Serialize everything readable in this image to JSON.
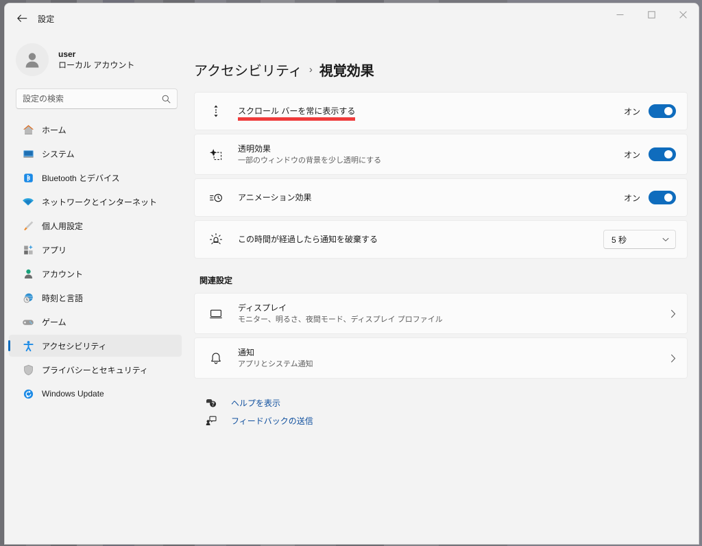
{
  "window": {
    "title": "設定",
    "back_label": "戻る",
    "minimize_label": "最小化",
    "maximize_label": "最大化",
    "close_label": "閉じる"
  },
  "sidebar": {
    "profile": {
      "name": "user",
      "account_type": "ローカル アカウント",
      "avatar_icon": "person-avatar-icon"
    },
    "search": {
      "placeholder": "設定の検索",
      "value": "",
      "icon": "search-icon"
    },
    "items": [
      {
        "label": "ホーム",
        "icon": "home-icon",
        "selected": false
      },
      {
        "label": "システム",
        "icon": "system-monitor-icon",
        "selected": false
      },
      {
        "label": "Bluetooth とデバイス",
        "icon": "bluetooth-icon",
        "selected": false
      },
      {
        "label": "ネットワークとインターネット",
        "icon": "wifi-icon",
        "selected": false
      },
      {
        "label": "個人用設定",
        "icon": "paintbrush-icon",
        "selected": false
      },
      {
        "label": "アプリ",
        "icon": "apps-icon",
        "selected": false
      },
      {
        "label": "アカウント",
        "icon": "account-person-icon",
        "selected": false
      },
      {
        "label": "時刻と言語",
        "icon": "clock-globe-icon",
        "selected": false
      },
      {
        "label": "ゲーム",
        "icon": "gamepad-icon",
        "selected": false
      },
      {
        "label": "アクセシビリティ",
        "icon": "accessibility-person-icon",
        "selected": true
      },
      {
        "label": "プライバシーとセキュリティ",
        "icon": "shield-icon",
        "selected": false
      },
      {
        "label": "Windows Update",
        "icon": "windows-update-icon",
        "selected": false
      }
    ]
  },
  "main": {
    "breadcrumb": {
      "parent": "アクセシビリティ",
      "separator": "›",
      "current": "視覚効果"
    },
    "settings": [
      {
        "title": "スクロール バーを常に表示する",
        "subtitle": "",
        "icon": "scrollbar-icon",
        "control": "toggle",
        "toggle_label": "オン",
        "toggle_on": true,
        "annotated": true
      },
      {
        "title": "透明効果",
        "subtitle": "一部のウィンドウの背景を少し透明にする",
        "icon": "transparency-icon",
        "control": "toggle",
        "toggle_label": "オン",
        "toggle_on": true,
        "annotated": false
      },
      {
        "title": "アニメーション効果",
        "subtitle": "",
        "icon": "animation-icon",
        "control": "toggle",
        "toggle_label": "オン",
        "toggle_on": true,
        "annotated": false
      },
      {
        "title": "この時間が経過したら通知を破棄する",
        "subtitle": "",
        "icon": "notification-brightness-icon",
        "control": "select",
        "select_value": "5 秒",
        "annotated": false
      }
    ],
    "related_section_title": "関連設定",
    "related": [
      {
        "title": "ディスプレイ",
        "subtitle": "モニター、明るさ、夜間モード、ディスプレイ プロファイル",
        "icon": "monitor-icon",
        "chevron": "chevron-right-icon"
      },
      {
        "title": "通知",
        "subtitle": "アプリとシステム通知",
        "icon": "bell-icon",
        "chevron": "chevron-right-icon"
      }
    ],
    "links": [
      {
        "label": "ヘルプを表示",
        "icon": "help-icon"
      },
      {
        "label": "フィードバックの送信",
        "icon": "feedback-icon"
      }
    ]
  },
  "colors": {
    "accent": "#0f6cbd",
    "annotation": "#ef3b3b",
    "link": "#0f4f9e",
    "window_bg": "#f3f3f3",
    "card_bg": "#fbfbfb"
  }
}
